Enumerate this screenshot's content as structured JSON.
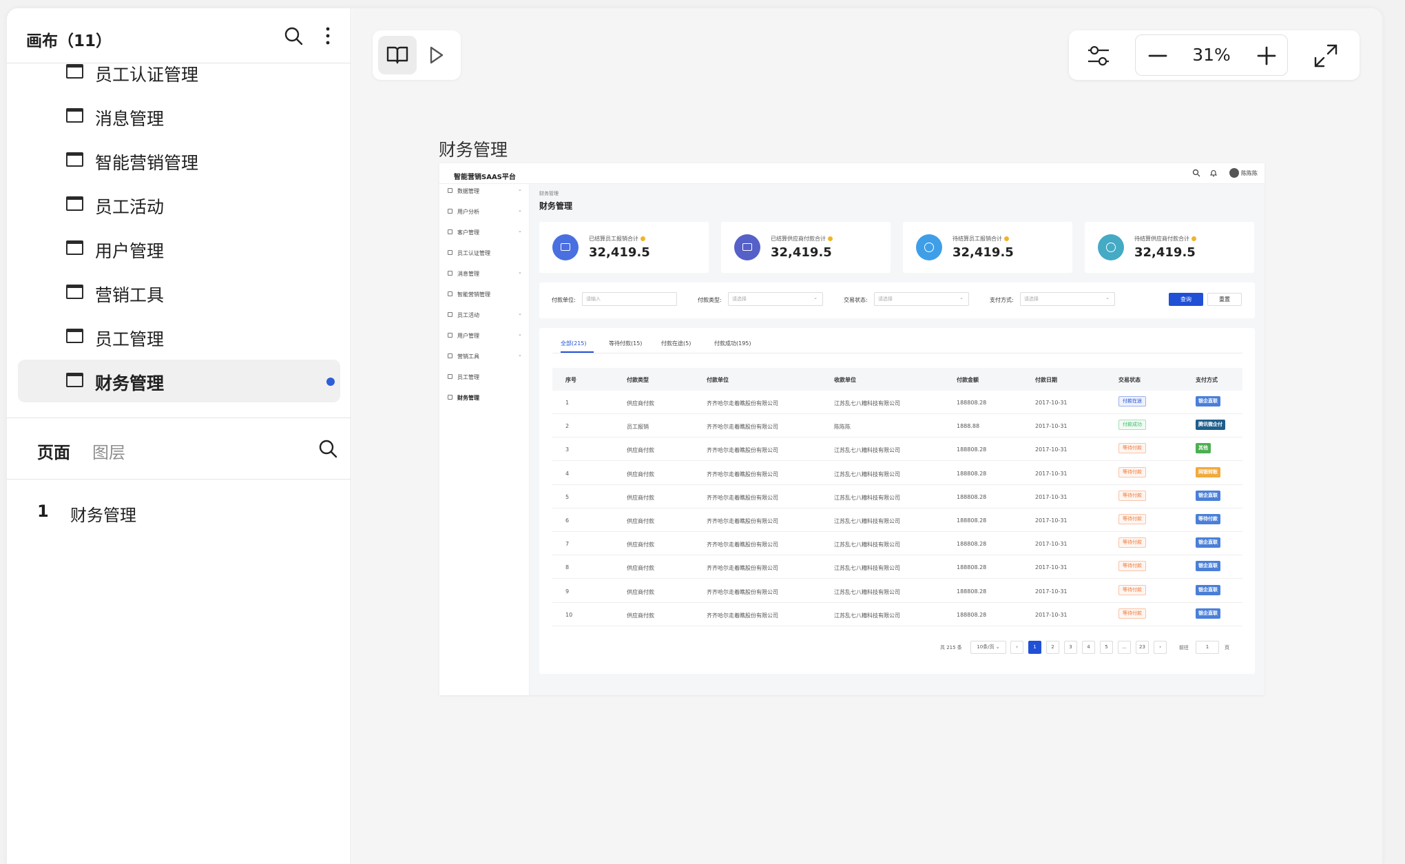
{
  "left_panel": {
    "title": "画布（11）",
    "canvases": [
      {
        "label": "员工认证管理",
        "active": false
      },
      {
        "label": "消息管理",
        "active": false
      },
      {
        "label": "智能营销管理",
        "active": false
      },
      {
        "label": "员工活动",
        "active": false
      },
      {
        "label": "用户管理",
        "active": false
      },
      {
        "label": "营销工具",
        "active": false
      },
      {
        "label": "员工管理",
        "active": false
      },
      {
        "label": "财务管理",
        "active": true
      }
    ],
    "tabs": {
      "pages": "页面",
      "layers": "图层"
    },
    "pages": [
      {
        "num": "1",
        "name": "财务管理"
      }
    ]
  },
  "toolbar": {
    "zoom": "31%"
  },
  "frame": {
    "title": "财务管理",
    "brand": "智能营销SAAS平台",
    "user": "陈陈陈",
    "nav": [
      {
        "label": "数据管理",
        "caret": true
      },
      {
        "label": "用户分析",
        "caret": true
      },
      {
        "label": "客户管理",
        "caret": true
      },
      {
        "label": "员工认证管理",
        "caret": false
      },
      {
        "label": "消息管理",
        "caret": true
      },
      {
        "label": "智能营销管理",
        "caret": false
      },
      {
        "label": "员工活动",
        "caret": true
      },
      {
        "label": "用户管理",
        "caret": true
      },
      {
        "label": "营销工具",
        "caret": true
      },
      {
        "label": "员工管理",
        "caret": false
      },
      {
        "label": "财务管理",
        "caret": false
      }
    ],
    "breadcrumb": "财务管理",
    "page_title": "财务管理",
    "stats": [
      {
        "label": "已结算员工报销合计",
        "value": "32,419.5",
        "color": "#4a6fe0",
        "icon": "wallet-icon"
      },
      {
        "label": "已结算供应商付款合计",
        "value": "32,419.5",
        "color": "#5560c8",
        "icon": "wallet-icon"
      },
      {
        "label": "待结算员工报销合计",
        "value": "32,419.5",
        "color": "#3f9ee8",
        "icon": "refresh-icon"
      },
      {
        "label": "待结算供应商付款合计",
        "value": "32,419.5",
        "color": "#45aac4",
        "icon": "refresh-icon"
      }
    ],
    "filters": {
      "unit_label": "付款单位:",
      "unit_ph": "请输入",
      "type_label": "付款类型:",
      "type_ph": "请选择",
      "status_label": "交易状态:",
      "status_ph": "请选择",
      "pay_label": "支付方式:",
      "pay_ph": "请选择",
      "query": "查询",
      "reset": "重置"
    },
    "tabs": [
      "全部(215)",
      "等待付款(15)",
      "付款在途(5)",
      "付款成功(195)"
    ],
    "columns": [
      "序号",
      "付款类型",
      "付款单位",
      "收款单位",
      "付款金额",
      "付款日期",
      "交易状态",
      "支付方式"
    ],
    "rows": [
      {
        "no": "1",
        "type": "供应商付款",
        "payer": "齐齐哈尔走着瞧股份有限公司",
        "payee": "江苏乱七八糟科技有限公司",
        "amount": "188808.28",
        "date": "2017-10-31",
        "status": "付款在途",
        "status_color": "#2050d6",
        "method": "银企直联",
        "method_color": "#4a7fd8"
      },
      {
        "no": "2",
        "type": "员工报销",
        "payer": "齐齐哈尔走着瞧股份有限公司",
        "payee": "陈陈陈",
        "amount": "1888.88",
        "date": "2017-10-31",
        "status": "付款成功",
        "status_color": "#3fb96a",
        "method": "腾讯微企付",
        "method_color": "#1f5e8c"
      },
      {
        "no": "3",
        "type": "供应商付款",
        "payer": "齐齐哈尔走着瞧股份有限公司",
        "payee": "江苏乱七八糟科技有限公司",
        "amount": "188808.28",
        "date": "2017-10-31",
        "status": "等待付款",
        "status_color": "#f07a3c",
        "method": "其他",
        "method_color": "#4caf50"
      },
      {
        "no": "4",
        "type": "供应商付款",
        "payer": "齐齐哈尔走着瞧股份有限公司",
        "payee": "江苏乱七八糟科技有限公司",
        "amount": "188808.28",
        "date": "2017-10-31",
        "status": "等待付款",
        "status_color": "#f07a3c",
        "method": "网银转账",
        "method_color": "#f2a93b"
      },
      {
        "no": "5",
        "type": "供应商付款",
        "payer": "齐齐哈尔走着瞧股份有限公司",
        "payee": "江苏乱七八糟科技有限公司",
        "amount": "188808.28",
        "date": "2017-10-31",
        "status": "等待付款",
        "status_color": "#f07a3c",
        "method": "银企直联",
        "method_color": "#4a7fd8"
      },
      {
        "no": "6",
        "type": "供应商付款",
        "payer": "齐齐哈尔走着瞧股份有限公司",
        "payee": "江苏乱七八糟科技有限公司",
        "amount": "188808.28",
        "date": "2017-10-31",
        "status": "等待付款",
        "status_color": "#f07a3c",
        "method": "等待付款",
        "method_color": "#4a7fd8"
      },
      {
        "no": "7",
        "type": "供应商付款",
        "payer": "齐齐哈尔走着瞧股份有限公司",
        "payee": "江苏乱七八糟科技有限公司",
        "amount": "188808.28",
        "date": "2017-10-31",
        "status": "等待付款",
        "status_color": "#f07a3c",
        "method": "银企直联",
        "method_color": "#4a7fd8"
      },
      {
        "no": "8",
        "type": "供应商付款",
        "payer": "齐齐哈尔走着瞧股份有限公司",
        "payee": "江苏乱七八糟科技有限公司",
        "amount": "188808.28",
        "date": "2017-10-31",
        "status": "等待付款",
        "status_color": "#f07a3c",
        "method": "银企直联",
        "method_color": "#4a7fd8"
      },
      {
        "no": "9",
        "type": "供应商付款",
        "payer": "齐齐哈尔走着瞧股份有限公司",
        "payee": "江苏乱七八糟科技有限公司",
        "amount": "188808.28",
        "date": "2017-10-31",
        "status": "等待付款",
        "status_color": "#f07a3c",
        "method": "银企直联",
        "method_color": "#4a7fd8"
      },
      {
        "no": "10",
        "type": "供应商付款",
        "payer": "齐齐哈尔走着瞧股份有限公司",
        "payee": "江苏乱七八糟科技有限公司",
        "amount": "188808.28",
        "date": "2017-10-31",
        "status": "等待付款",
        "status_color": "#f07a3c",
        "method": "银企直联",
        "method_color": "#4a7fd8"
      }
    ],
    "pager": {
      "total": "共 215 条",
      "size": "10条/页",
      "prev": "‹",
      "pages": [
        "1",
        "2",
        "3",
        "4",
        "5",
        "...",
        "23"
      ],
      "next": "›",
      "goto": "前往",
      "goto_value": "1",
      "page_unit": "页"
    }
  }
}
